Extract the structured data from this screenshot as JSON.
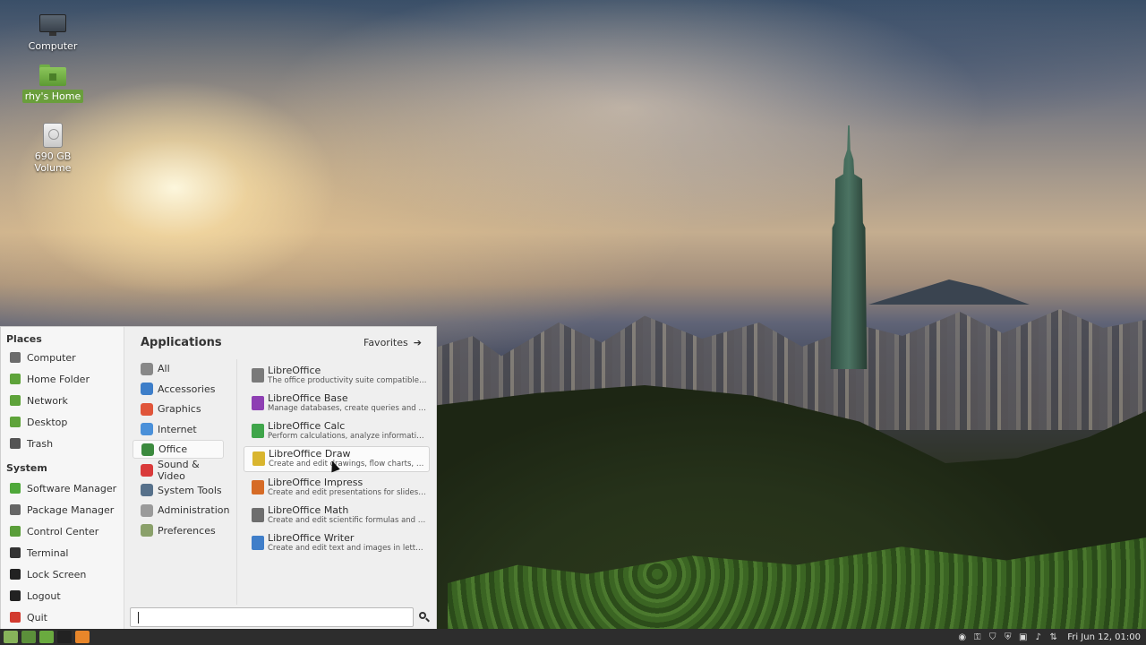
{
  "desktop": {
    "icons": [
      {
        "label": "Computer",
        "icon": "monitor-icon"
      },
      {
        "label": "rhy's Home",
        "icon": "home-folder-icon"
      },
      {
        "label": "690 GB Volume",
        "icon": "drive-icon"
      }
    ]
  },
  "menu": {
    "places_title": "Places",
    "places": [
      {
        "label": "Computer",
        "icon": "computer-icon",
        "color": "#6c6c6c"
      },
      {
        "label": "Home Folder",
        "icon": "home-folder-icon",
        "color": "#5ea33a"
      },
      {
        "label": "Network",
        "icon": "network-folder-icon",
        "color": "#5ea33a"
      },
      {
        "label": "Desktop",
        "icon": "desktop-folder-icon",
        "color": "#5ea33a"
      },
      {
        "label": "Trash",
        "icon": "trash-icon",
        "color": "#555555"
      }
    ],
    "system_title": "System",
    "system": [
      {
        "label": "Software Manager",
        "icon": "software-manager-icon",
        "color": "#4fa83a"
      },
      {
        "label": "Package Manager",
        "icon": "package-manager-icon",
        "color": "#666666"
      },
      {
        "label": "Control Center",
        "icon": "control-center-icon",
        "color": "#5a9e3a"
      },
      {
        "label": "Terminal",
        "icon": "terminal-icon",
        "color": "#333333"
      },
      {
        "label": "Lock Screen",
        "icon": "lock-icon",
        "color": "#222222"
      },
      {
        "label": "Logout",
        "icon": "logout-icon",
        "color": "#222222"
      },
      {
        "label": "Quit",
        "icon": "quit-icon",
        "color": "#d23a2e"
      }
    ],
    "apps_title": "Applications",
    "favorites_label": "Favorites",
    "categories": [
      {
        "label": "All",
        "icon": "grid-icon",
        "color": "#888888"
      },
      {
        "label": "Accessories",
        "icon": "accessories-icon",
        "color": "#3d7ec9"
      },
      {
        "label": "Graphics",
        "icon": "graphics-icon",
        "color": "#e0553a"
      },
      {
        "label": "Internet",
        "icon": "internet-icon",
        "color": "#4a90d9"
      },
      {
        "label": "Office",
        "icon": "office-icon",
        "color": "#3b8a3e"
      },
      {
        "label": "Sound & Video",
        "icon": "sound-video-icon",
        "color": "#d93a3a"
      },
      {
        "label": "System Tools",
        "icon": "system-tools-icon",
        "color": "#56708a"
      },
      {
        "label": "Administration",
        "icon": "administration-icon",
        "color": "#9a9a9a"
      },
      {
        "label": "Preferences",
        "icon": "preferences-icon",
        "color": "#8aa06a"
      }
    ],
    "active_category": "Office",
    "apps": [
      {
        "name": "LibreOffice",
        "desc": "The office productivity suite compatible t...",
        "icon": "libreoffice-icon",
        "color": "#7a7a7a"
      },
      {
        "name": "LibreOffice Base",
        "desc": "Manage databases, create queries and re...",
        "icon": "libreoffice-base-icon",
        "color": "#8e3fb3"
      },
      {
        "name": "LibreOffice Calc",
        "desc": "Perform calculations, analyze informatio...",
        "icon": "libreoffice-calc-icon",
        "color": "#3fa54a"
      },
      {
        "name": "LibreOffice Draw",
        "desc": "Create and edit drawings, flow charts, an...",
        "icon": "libreoffice-draw-icon",
        "color": "#d9b52e"
      },
      {
        "name": "LibreOffice Impress",
        "desc": "Create and edit presentations for slidesh...",
        "icon": "libreoffice-impress-icon",
        "color": "#d66b26"
      },
      {
        "name": "LibreOffice Math",
        "desc": "Create and edit scientific formulas and eq...",
        "icon": "libreoffice-math-icon",
        "color": "#6e6e6e"
      },
      {
        "name": "LibreOffice Writer",
        "desc": "Create and edit text and images in letters,...",
        "icon": "libreoffice-writer-icon",
        "color": "#3f7ec9"
      }
    ],
    "hovered_app": "LibreOffice Draw",
    "search": {
      "value": "",
      "placeholder": ""
    }
  },
  "taskbar": {
    "launchers": [
      {
        "icon": "mint-menu-icon",
        "color": "#87b35a"
      },
      {
        "icon": "show-desktop-icon",
        "color": "#5b8f3a"
      },
      {
        "icon": "files-icon",
        "color": "#6aaa3f"
      },
      {
        "icon": "terminal-icon",
        "color": "#222222"
      },
      {
        "icon": "firefox-icon",
        "color": "#e8862a"
      }
    ],
    "tray": [
      "chrome-icon",
      "key-icon",
      "shield-icon",
      "security-icon",
      "window-icon",
      "volume-icon",
      "network-icon"
    ],
    "clock": "Fri Jun 12, 01:00"
  }
}
